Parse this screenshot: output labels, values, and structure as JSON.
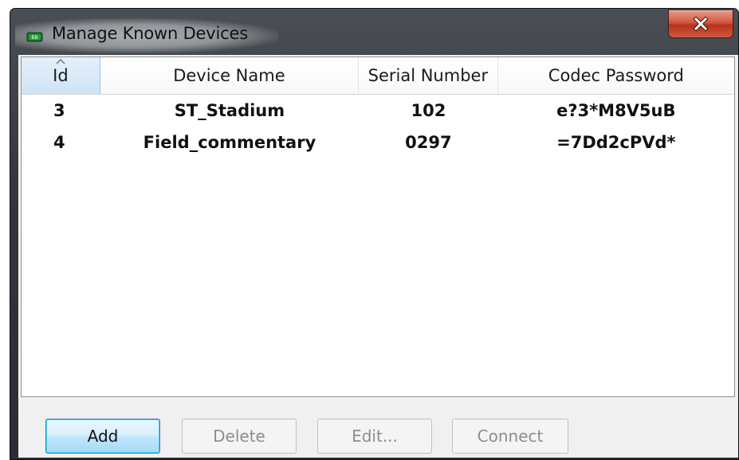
{
  "window": {
    "title": "Manage Known Devices",
    "app_icon": "app-logo-icon",
    "close_icon": "close-icon"
  },
  "table": {
    "columns": [
      "Id",
      "Device Name",
      "Serial Number",
      "Codec Password"
    ],
    "sorted_column": "Id",
    "rows": [
      {
        "id": "3",
        "device_name": "ST_Stadium",
        "serial_number": "102",
        "codec_password": "e?3*M8V5uB"
      },
      {
        "id": "4",
        "device_name": "Field_commentary",
        "serial_number": "0297",
        "codec_password": "=7Dd2cPVd*"
      }
    ]
  },
  "buttons": {
    "add": "Add",
    "delete": "Delete",
    "edit": "Edit...",
    "connect": "Connect"
  },
  "colors": {
    "close_button": "#c9422a",
    "default_button": "#bee6fd",
    "sorted_header": "#d9e9f8"
  }
}
